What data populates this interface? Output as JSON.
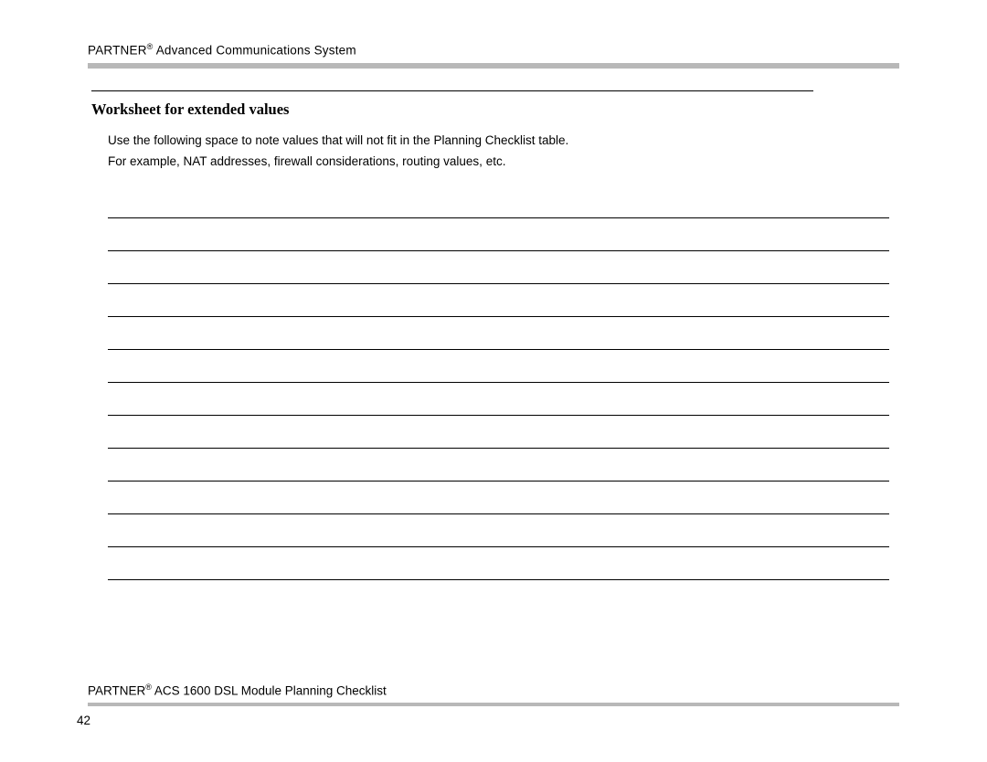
{
  "header": {
    "product": "PARTNER",
    "suffix": " Advanced Communications System"
  },
  "section": {
    "heading": "Worksheet for extended values",
    "para1": "Use the following space to note values that will not fit in the Planning Checklist table.",
    "para2": "For example, NAT addresses, firewall considerations, routing values, etc."
  },
  "worksheet": {
    "line_count": 12
  },
  "footer": {
    "product": "PARTNER",
    "suffix": " ACS 1600 DSL Module Planning Checklist",
    "page_number": "42"
  }
}
